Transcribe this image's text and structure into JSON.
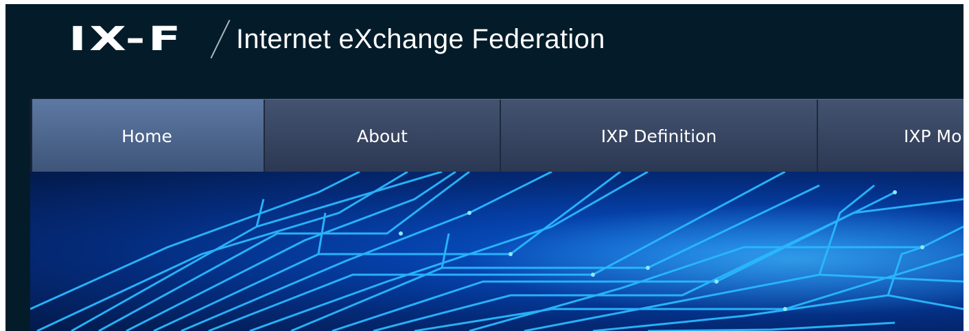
{
  "header": {
    "logo_mark": "IX-F",
    "site_name": "Internet eXchange Federation"
  },
  "nav": {
    "items": [
      {
        "label": "Home",
        "active": true
      },
      {
        "label": "About",
        "active": false
      },
      {
        "label": "IXP Definition",
        "active": false
      },
      {
        "label": "IXP Mo",
        "active": false
      }
    ]
  },
  "colors": {
    "header_bg": "#041c2a",
    "nav_bg": "#2c3853",
    "nav_active": "#5d78a3",
    "banner_glow": "#1fb6ff"
  }
}
